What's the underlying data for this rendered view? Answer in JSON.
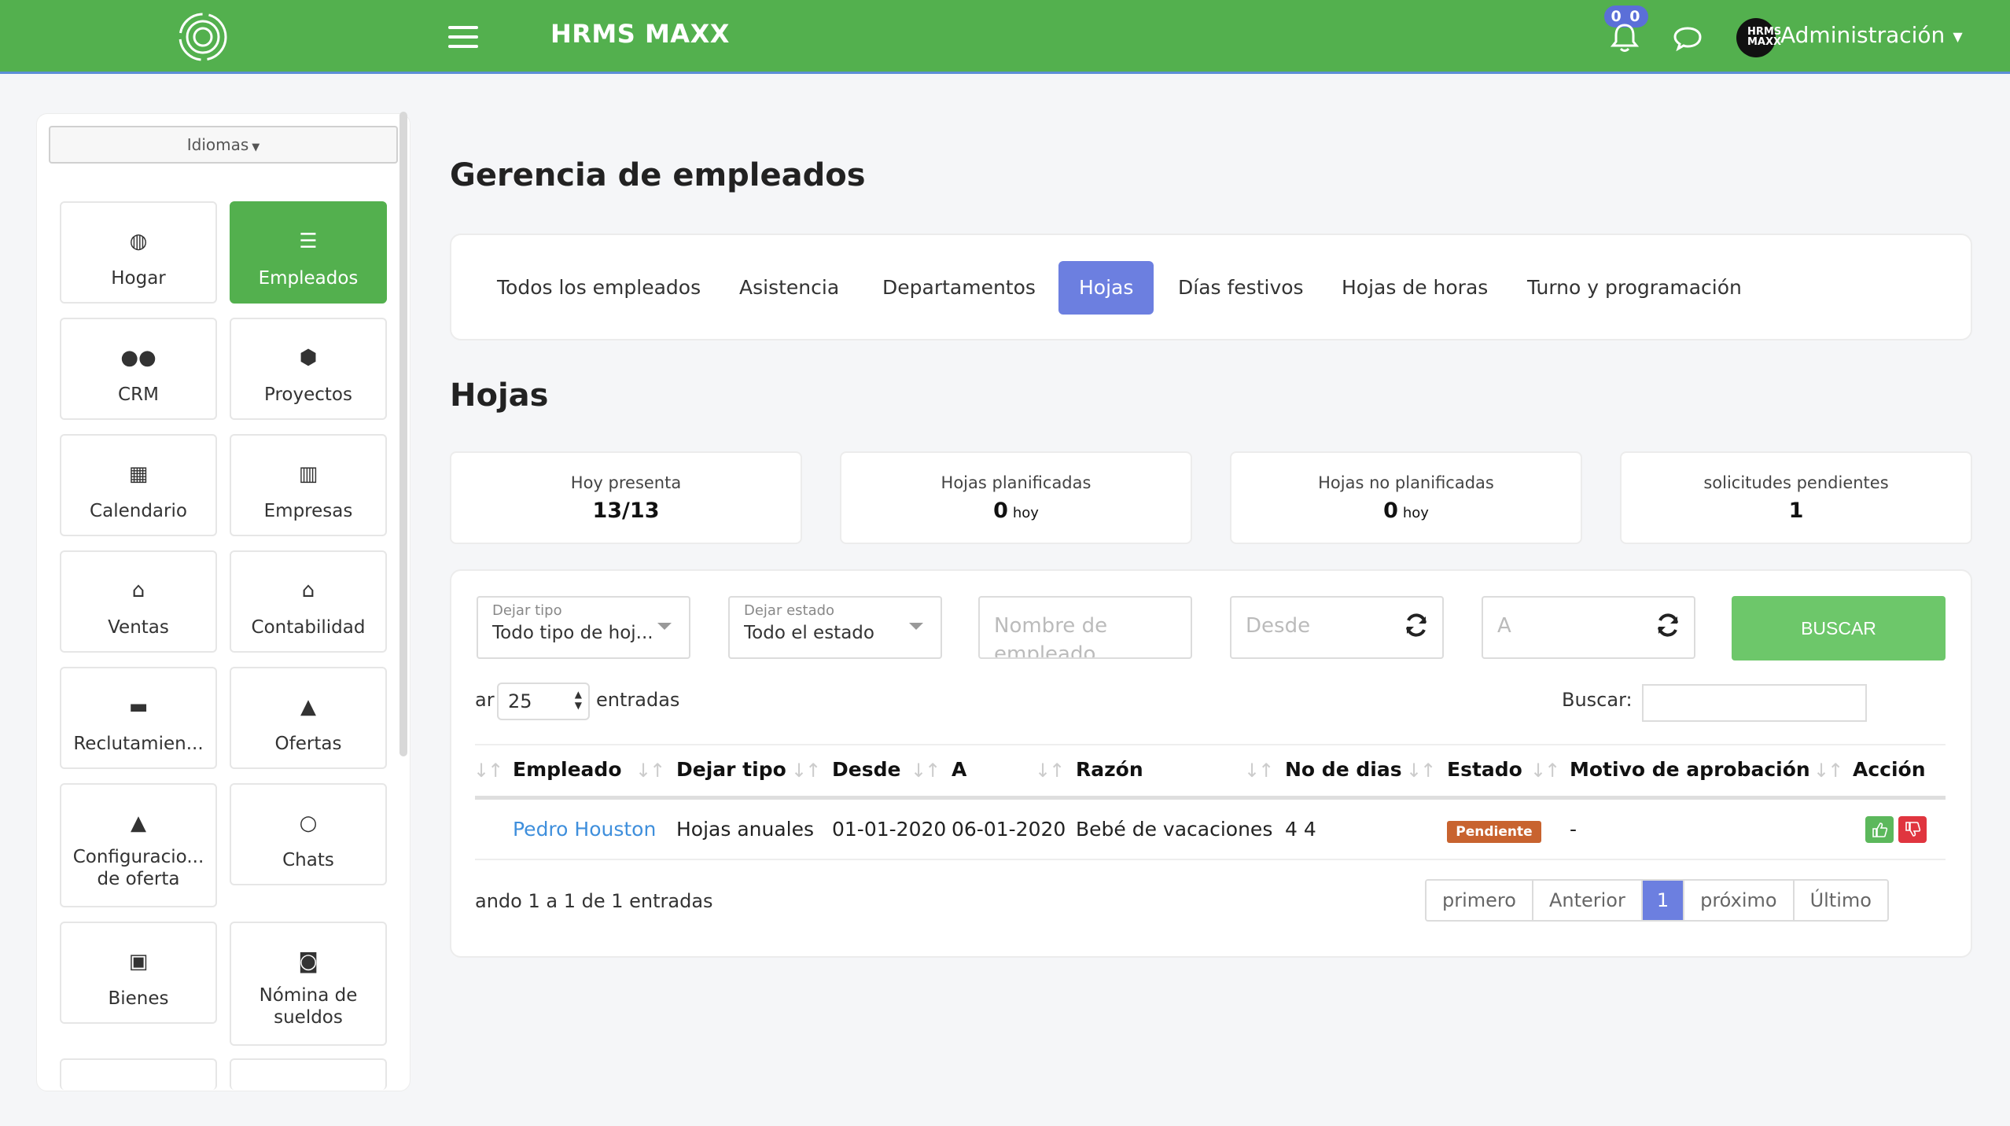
{
  "header": {
    "app_title": "HRMS MAXX",
    "notifications_badge": "0 0",
    "avatar_text": "HRMS MAXX",
    "user_menu_label": "Administración",
    "accent_color": "#53b04e"
  },
  "sidebar": {
    "language_button": "Idiomas",
    "tiles": [
      {
        "label": "Hogar",
        "icon": "dashboard-icon",
        "active": false
      },
      {
        "label": "Empleados",
        "icon": "list-icon",
        "active": true
      },
      {
        "label": "CRM",
        "icon": "users-icon",
        "active": false
      },
      {
        "label": "Proyectos",
        "icon": "cubes-icon",
        "active": false
      },
      {
        "label": "Calendario",
        "icon": "calendar-icon",
        "active": false
      },
      {
        "label": "Empresas",
        "icon": "building-icon",
        "active": false
      },
      {
        "label": "Ventas",
        "icon": "bank-icon",
        "active": false
      },
      {
        "label": "Contabilidad",
        "icon": "bank-icon",
        "active": false
      },
      {
        "label": "Reclutamien...",
        "icon": "briefcase-icon",
        "active": false
      },
      {
        "label": "Ofertas",
        "icon": "graduation-cap-icon",
        "active": false
      },
      {
        "label": "Configuracio... de oferta",
        "icon": "graduation-cap-icon",
        "active": false
      },
      {
        "label": "Chats",
        "icon": "chat-bubble-icon",
        "active": false
      },
      {
        "label": "Bienes",
        "icon": "object-group-icon",
        "active": false
      },
      {
        "label": "Nómina de sueldos",
        "icon": "money-icon",
        "active": false
      }
    ]
  },
  "main": {
    "page_title": "Gerencia de empleados",
    "tabs": [
      {
        "label": "Todos los empleados",
        "active": false
      },
      {
        "label": "Asistencia",
        "active": false
      },
      {
        "label": "Departamentos",
        "active": false
      },
      {
        "label": "Hojas",
        "active": true
      },
      {
        "label": "Días festivos",
        "active": false
      },
      {
        "label": "Hojas de horas",
        "active": false
      },
      {
        "label": "Turno y programación",
        "active": false
      }
    ],
    "section_title": "Hojas",
    "stats": [
      {
        "title": "Hoy presenta",
        "value": "13/13",
        "suffix": ""
      },
      {
        "title": "Hojas planificadas",
        "value": "0",
        "suffix": "hoy"
      },
      {
        "title": "Hojas no planificadas",
        "value": "0",
        "suffix": "hoy"
      },
      {
        "title": "solicitudes pendientes",
        "value": "1",
        "suffix": ""
      }
    ],
    "filters": {
      "leave_type_caption": "Dejar tipo",
      "leave_type_value": "Todo tipo de hoj...",
      "leave_status_caption": "Dejar estado",
      "leave_status_value": "Todo el estado",
      "employee_name_placeholder": "Nombre de empleado",
      "from_placeholder": "Desde",
      "to_placeholder": "A",
      "search_button": "BUSCAR"
    },
    "table_controls": {
      "show_prefix": "ar",
      "page_size": "25",
      "entries_label": "entradas",
      "search_label": "Buscar:",
      "search_value": ""
    },
    "table": {
      "columns": [
        "Empleado",
        "Dejar tipo",
        "Desde",
        "A",
        "Razón",
        "No de dias",
        "Estado",
        "Motivo de aprobación",
        "Acción"
      ],
      "rows": [
        {
          "employee": "Pedro Houston",
          "leave_type": "Hojas anuales",
          "from": "01-01-2020",
          "to": "06-01-2020",
          "reason": "Bebé de vacaciones",
          "days": "4 4",
          "status": "Pendiente",
          "approval_reason": "-"
        }
      ]
    },
    "info_text": "ando 1 a 1 de 1 entradas",
    "pagination": {
      "first": "primero",
      "previous": "Anterior",
      "current": "1",
      "next": "próximo",
      "last": "Último"
    }
  }
}
